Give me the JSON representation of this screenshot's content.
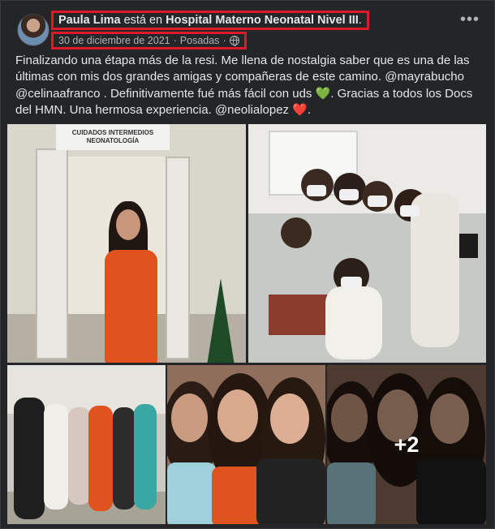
{
  "post": {
    "author": "Paula Lima",
    "action": "está en",
    "place": "Hospital Materno Neonatal Nivel III",
    "place_suffix": ".",
    "date": "30 de diciembre de 2021",
    "separator": "·",
    "album": "Posadas",
    "privacy_icon": "globe-icon",
    "text": {
      "part1": "Finalizando una étapa más de la resi. Me llena de nostalgia saber que es una de las últimas con mis dos grandes amigas y compañeras de este camino. @mayrabucho @celinaafranco . Definitivamente fué más fácil con uds ",
      "emoji1": "💚",
      "part2": ". Gracias a todos los Docs del HMN. Una hermosa experiencia. @neolialopez ",
      "emoji2": "❤️",
      "part3": "."
    }
  },
  "photos": {
    "sign_line1": "CUIDADOS INTERMEDIOS",
    "sign_line2": "NEONATOLOGÍA",
    "more_count": "+2"
  },
  "colors": {
    "highlight": "#e0182b",
    "background": "#242526",
    "text": "#e4e6eb",
    "muted": "#b0b3b8"
  }
}
